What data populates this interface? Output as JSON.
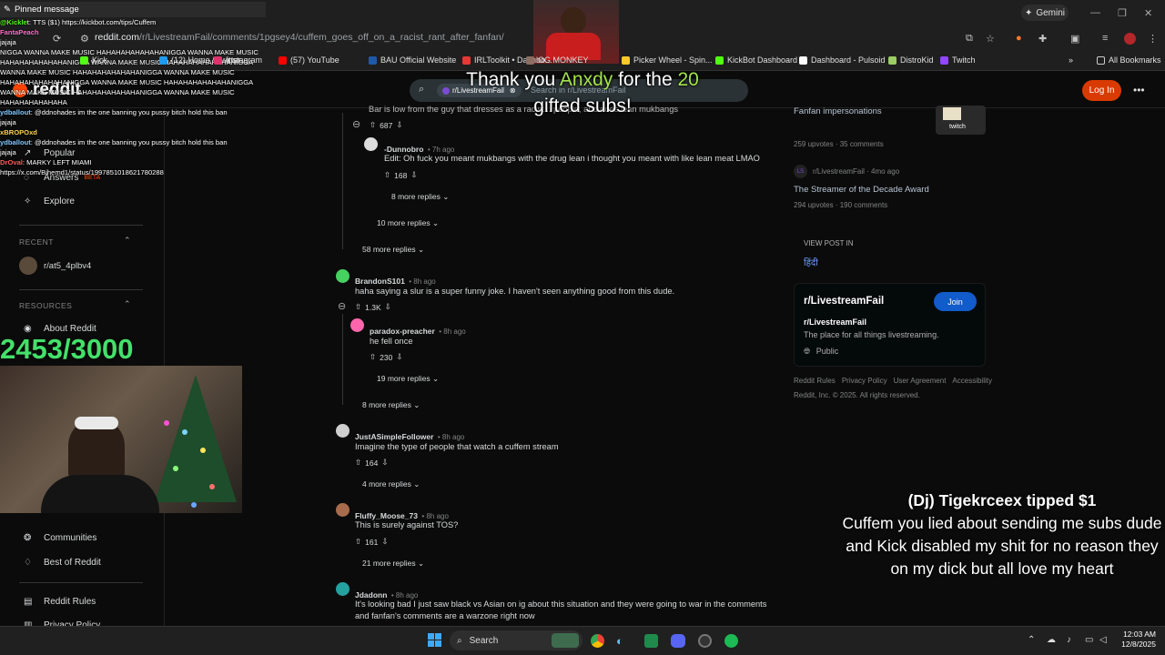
{
  "browser": {
    "url_host": "reddit.com",
    "url_path": "/r/LivestreamFail/comments/1pgsey4/cuffem_goes_off_on_a_racist_rant_after_fanfan/",
    "gemini_label": "Gemini",
    "bookmarks": [
      {
        "label": "Kick",
        "color": "#53fc18"
      },
      {
        "label": "(12) Home / Twitter",
        "color": "#1d9bf0"
      },
      {
        "label": "Instagram",
        "color": "#e1306c"
      },
      {
        "label": "(57) YouTube",
        "color": "#ff0000"
      },
      {
        "label": "BAU Official Website",
        "color": "#1e5aa8"
      },
      {
        "label": "IRLToolkit • Dashbo...",
        "color": "#e53935"
      },
      {
        "label": "OG MONKEY",
        "color": "#8d6e63"
      },
      {
        "label": "Picker Wheel - Spin...",
        "color": "#ffca28"
      },
      {
        "label": "KickBot Dashboard",
        "color": "#53fc18"
      },
      {
        "label": "Dashboard - Pulsoid",
        "color": "#fafafa"
      },
      {
        "label": "DistroKid",
        "color": "#9ccc65"
      },
      {
        "label": "Twitch",
        "color": "#9146ff"
      }
    ],
    "all_bookmarks": "All Bookmarks"
  },
  "reddit": {
    "logo_text": "reddit",
    "search_chip": "r/LivestreamFail",
    "search_placeholder": "Search in r/LivestreamFail",
    "login_label": "Log In"
  },
  "sidebar": {
    "nav": [
      "Popular",
      "Answers",
      "Explore"
    ],
    "answers_badge": "BETA",
    "recent_label": "RECENT",
    "recent_item": "r/at5_4plbv4",
    "resources_label": "RESOURCES",
    "about": "About Reddit",
    "communities": "Communities",
    "best": "Best of Reddit",
    "rules": "Reddit Rules",
    "privacy": "Privacy Policy"
  },
  "comments": {
    "top_partial": "Bar is low from the guy that dresses as a racist... people, and does lean mukbangs",
    "top_votes": "687",
    "c1": {
      "author": "-Dunnobro",
      "time": "• 7h ago",
      "body": "Edit: Oh fuck you meant mukbangs with the drug lean i thought you meant with like lean meat LMAO",
      "votes": "168"
    },
    "more1": "8 more replies",
    "more2": "10 more replies",
    "more3": "58 more replies",
    "c2": {
      "author": "BrandonS101",
      "time": "• 8h ago",
      "body": "haha saying a slur is a super funny joke. I haven't seen anything good from this dude.",
      "votes": "1.3K"
    },
    "c3": {
      "author": "paradox-preacher",
      "time": "• 8h ago",
      "body": "he fell once",
      "votes": "230"
    },
    "more4": "19 more replies",
    "more5": "8 more replies",
    "c4": {
      "author": "JustASimpleFollower",
      "time": "• 8h ago",
      "body": "Imagine the type of people that watch a cuffem stream",
      "votes": "164"
    },
    "more6": "4 more replies",
    "c5": {
      "author": "Fluffy_Moose_73",
      "time": "• 8h ago",
      "body": "This is surely against TOS?",
      "votes": "161"
    },
    "more7": "21 more replies",
    "c6": {
      "author": "Jdadonn",
      "time": "• 8h ago",
      "body_l1": "It's looking bad I just saw black vs Asian on ig about this situation and they were going to war in the comments",
      "body_l2": "and fanfan's comments are a warzone right now"
    }
  },
  "right": {
    "post1_title": "Fanfan impersonations",
    "post1_meta": "259 upvotes · 35 comments",
    "post2_sub": "r/LivestreamFail · 4mo ago",
    "post2_title": "The Streamer of the Decade Award",
    "post2_meta": "294 upvotes · 190 comments",
    "view_post": "VIEW POST IN",
    "lang_icon": "हिंदी",
    "card_title": "r/LivestreamFail",
    "join": "Join",
    "card_sub": "r/LivestreamFail",
    "card_desc": "The place for all things livestreaming.",
    "card_public": "Public",
    "footer_links": [
      "Reddit Rules",
      "Privacy Policy",
      "User Agreement",
      "Accessibility"
    ],
    "copyright": "Reddit, Inc. © 2025. All rights reserved."
  },
  "overlay": {
    "pinned": "Pinned message",
    "chat": [
      {
        "user": "@Kickle",
        "userColor": "#53fc18",
        "text": "t: TTS ($1) https://kickbot.com/tips/Cuffem"
      },
      {
        "user": "FantaPeach",
        "userColor": "#ff6ec7",
        "text": ""
      },
      {
        "user": "",
        "userColor": "#fff",
        "text": "jajaja"
      },
      {
        "user": "",
        "userColor": "#fff",
        "text": "NIGGA WANNA MAKE MUSIC HAHAHAHAHAHAHANIGGA WANNA MAKE MUSIC HAHAHAHAHAHAHANIGGA WANNA MAKE MUSIC HAHAHAHAHAHAHANIGGA WANNA MAKE MUSIC HAHAHAHAHAHAHANIGGA WANNA MAKE MUSIC HAHAHAHAHAHAHANIGGA WANNA MAKE MUSIC HAHAHAHAHAHAHANIGGA WANNA MAKE MUSIC HAHAHAHAHAHAHANIGGA WANNA MAKE MUSIC HAHAHAHAHAHAHA"
      },
      {
        "user": "ydballout",
        "userColor": "#7ec8ff",
        "text": ": @ddnohades im the one banning you pussy bitch hold this ban"
      },
      {
        "user": "",
        "userColor": "#fff",
        "text": "jajaja"
      },
      {
        "user": "xBROPOxd",
        "userColor": "#ffd24d",
        "text": ""
      },
      {
        "user": "ydballout",
        "userColor": "#7ec8ff",
        "text": ": @ddnohades im the one banning you pussy bitch hold this ban"
      },
      {
        "user": "",
        "userColor": "#fff",
        "text": "jajaja"
      },
      {
        "user": "DrOval",
        "userColor": "#ff5a5a",
        "text": ": MARKY LEFT MIAMI"
      },
      {
        "user": "",
        "userColor": "#fff",
        "text": "https://x.com/Bihemd1/status/1997851018621780288"
      }
    ],
    "sub_goal": "2453/3000",
    "alert_pre": "Thank you ",
    "alert_name": "Anxdy",
    "alert_mid": " for the ",
    "alert_num": "20",
    "alert_line2": "gifted subs!",
    "tip_title": "(Dj) Tigekrceex tipped $1",
    "tip_message": "Cuffem you lied about sending me subs dude and Kick disabled my shit for no reason they on my dick but all love my heart"
  },
  "taskbar": {
    "search": "Search",
    "time": "12:03 AM",
    "date": "12/8/2025"
  }
}
